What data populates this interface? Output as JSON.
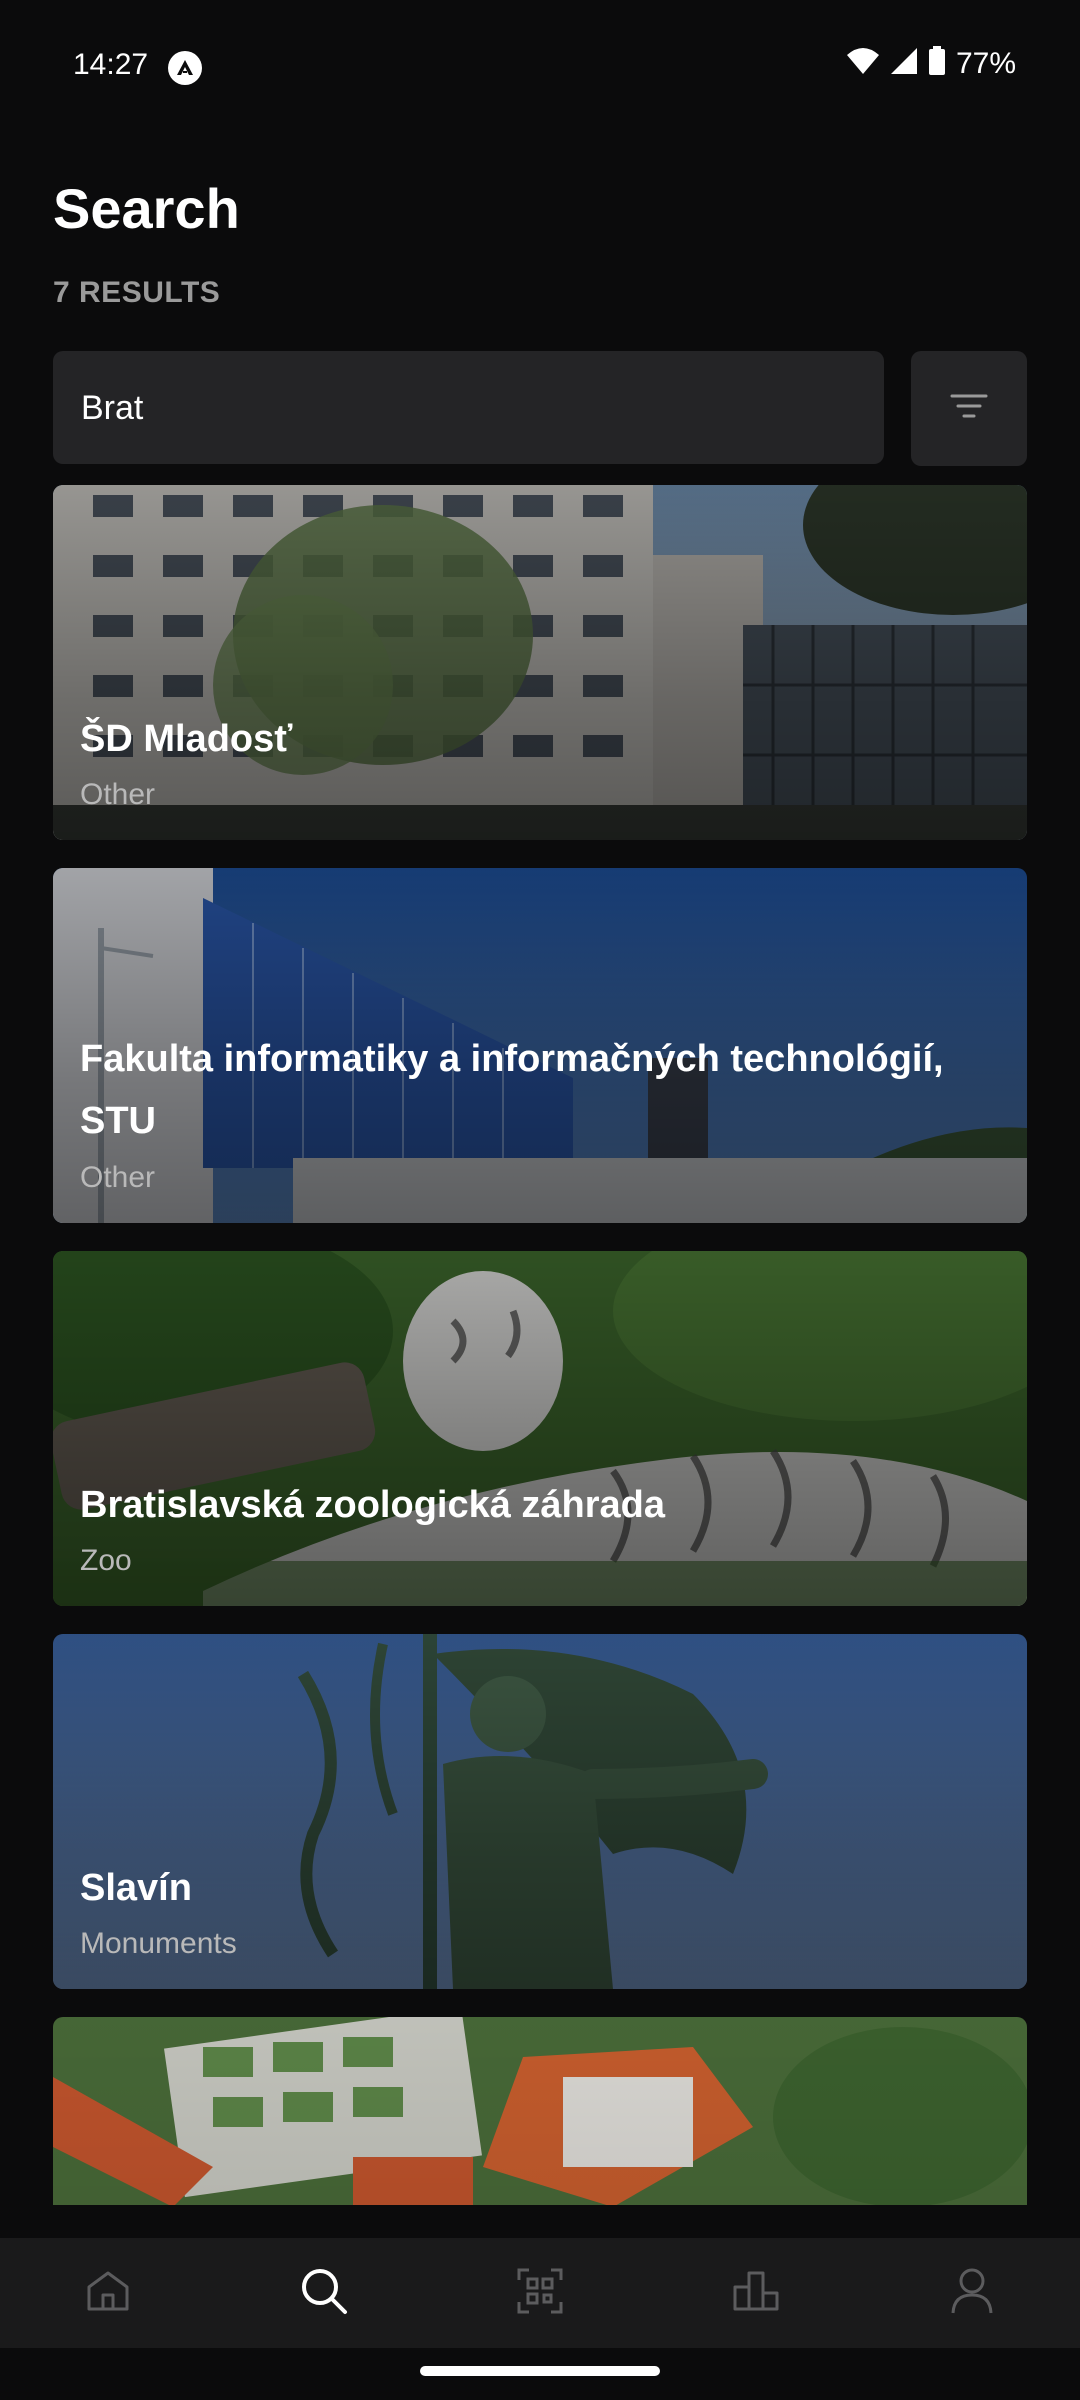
{
  "status_bar": {
    "time": "14:27",
    "battery": "77%",
    "icons": [
      "app-icon",
      "wifi-icon",
      "signal-icon",
      "battery-icon"
    ]
  },
  "header": {
    "title": "Search",
    "result_count": "7 RESULTS"
  },
  "search": {
    "value": "Brat",
    "placeholder": ""
  },
  "results": [
    {
      "name": "ŠD Mladosť",
      "category": "Other"
    },
    {
      "name": "Fakulta informatiky a informačných technológií, STU",
      "category": "Other"
    },
    {
      "name": "Bratislavská zoologická záhrada",
      "category": "Zoo"
    },
    {
      "name": "Slavín",
      "category": "Monuments"
    },
    {
      "name": "",
      "category": ""
    }
  ],
  "bottom_nav": {
    "items": [
      {
        "icon": "home-icon",
        "active": false
      },
      {
        "icon": "search-icon",
        "active": true
      },
      {
        "icon": "qr-scan-icon",
        "active": false
      },
      {
        "icon": "leaderboard-icon",
        "active": false
      },
      {
        "icon": "profile-icon",
        "active": false
      }
    ]
  },
  "colors": {
    "background": "#0b0b0c",
    "surface": "#242426",
    "nav_background": "#1a1a1b",
    "muted_text": "#9a9a9a",
    "active_icon": "#ffffff",
    "inactive_icon": "#5c5c5e"
  }
}
